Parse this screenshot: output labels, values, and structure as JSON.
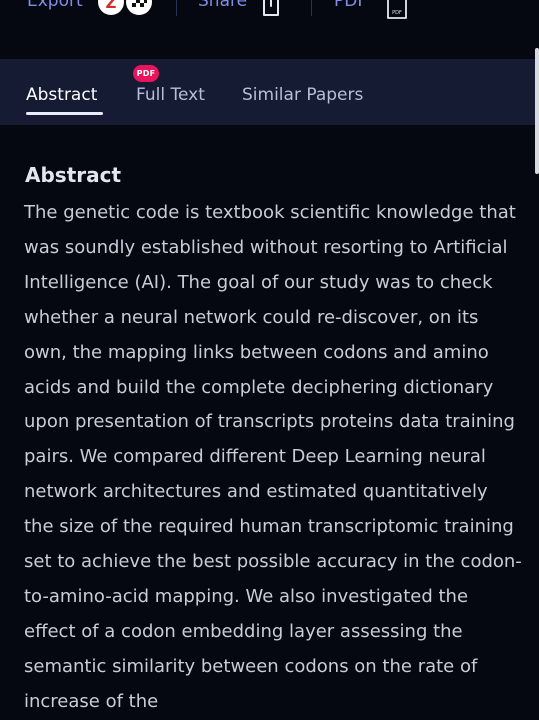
{
  "toolbar": {
    "export_label": "Export",
    "zotero_badge": "Z",
    "share_label": "Share",
    "pdf_label": "PDF",
    "pdf_icon_text": "PDF"
  },
  "tabs": [
    {
      "label": "Abstract",
      "active": true
    },
    {
      "label": "Full Text",
      "badge": "PDF",
      "active": false
    },
    {
      "label": "Similar Papers",
      "active": false
    }
  ],
  "colors": {
    "background": "#050811",
    "tabbar": "#141b32",
    "accent": "#7f8ee6",
    "badge": "#e8155c"
  },
  "abstract": {
    "title": "Abstract",
    "body": "The genetic code is textbook scientific knowledge that was soundly established without resorting to Artificial Intelligence (AI). The goal of our study was to check whether a neural network could re-discover, on its own, the mapping links between codons and amino acids and build the complete deciphering dictionary upon presentation of transcripts proteins data training pairs. We compared different Deep Learning neural network architectures and estimated quantitatively the size of the required human transcriptomic training set to achieve the best possible accuracy in the codon-to-amino-acid mapping. We also investigated the effect of a codon embedding layer assessing the semantic similarity between codons on the rate of increase of the"
  }
}
